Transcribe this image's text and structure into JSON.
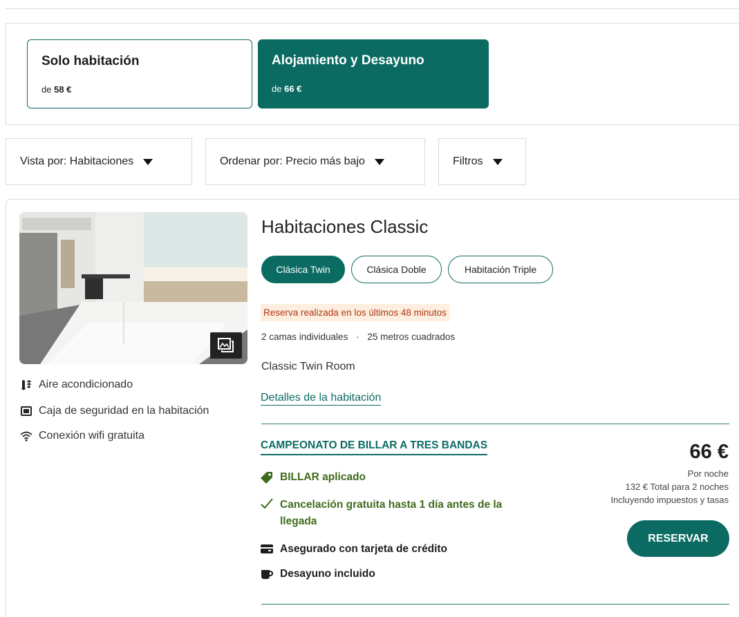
{
  "board_options": [
    {
      "title": "Solo habitación",
      "price_prefix": "de",
      "price": "58 €",
      "selected": false
    },
    {
      "title": "Alojamiento y Desayuno",
      "price_prefix": "de",
      "price": "66 €",
      "selected": true
    }
  ],
  "controls": {
    "view_label": "Vista por:",
    "view_value": "Habitaciones",
    "sort_label": "Ordenar por:",
    "sort_value": "Precio más bajo",
    "filters_label": "Filtros"
  },
  "room": {
    "title": "Habitaciones Classic",
    "types": [
      {
        "label": "Clásica Twin",
        "active": true
      },
      {
        "label": "Clásica Doble",
        "active": false
      },
      {
        "label": "Habitación Triple",
        "active": false
      }
    ],
    "urgency": "Reserva realizada en los últimos 48 minutos",
    "beds": "2 camas individuales",
    "size": "25 metros cuadrados",
    "description": "Classic Twin Room",
    "details_link": "Detalles de la habitación",
    "amenities": [
      {
        "icon": "air-conditioning-icon",
        "label": "Aire acondicionado"
      },
      {
        "icon": "safe-box-icon",
        "label": "Caja de seguridad en la habitación"
      },
      {
        "icon": "wifi-icon",
        "label": "Conexión wifi gratuita"
      }
    ]
  },
  "rate": {
    "name": "CAMPEONATO DE BILLAR A TRES BANDAS",
    "promo": "BILLAR aplicado",
    "cancellation_line1": "Cancelación gratuita hasta 1 día antes de la",
    "cancellation_line2": "llegada",
    "guarantee": "Asegurado con tarjeta de crédito",
    "breakfast": "Desayuno incluido",
    "price": "66 €",
    "per_night": "Por noche",
    "total": "132 € Total para 2 noches",
    "taxes": "Incluyendo impuestos y tasas",
    "reserve_label": "RESERVAR"
  },
  "colors": {
    "brand": "#0b6b63",
    "promo_green": "#3f6b1c",
    "urgency_bg": "#fdeee0",
    "urgency_text": "#b13a12"
  }
}
